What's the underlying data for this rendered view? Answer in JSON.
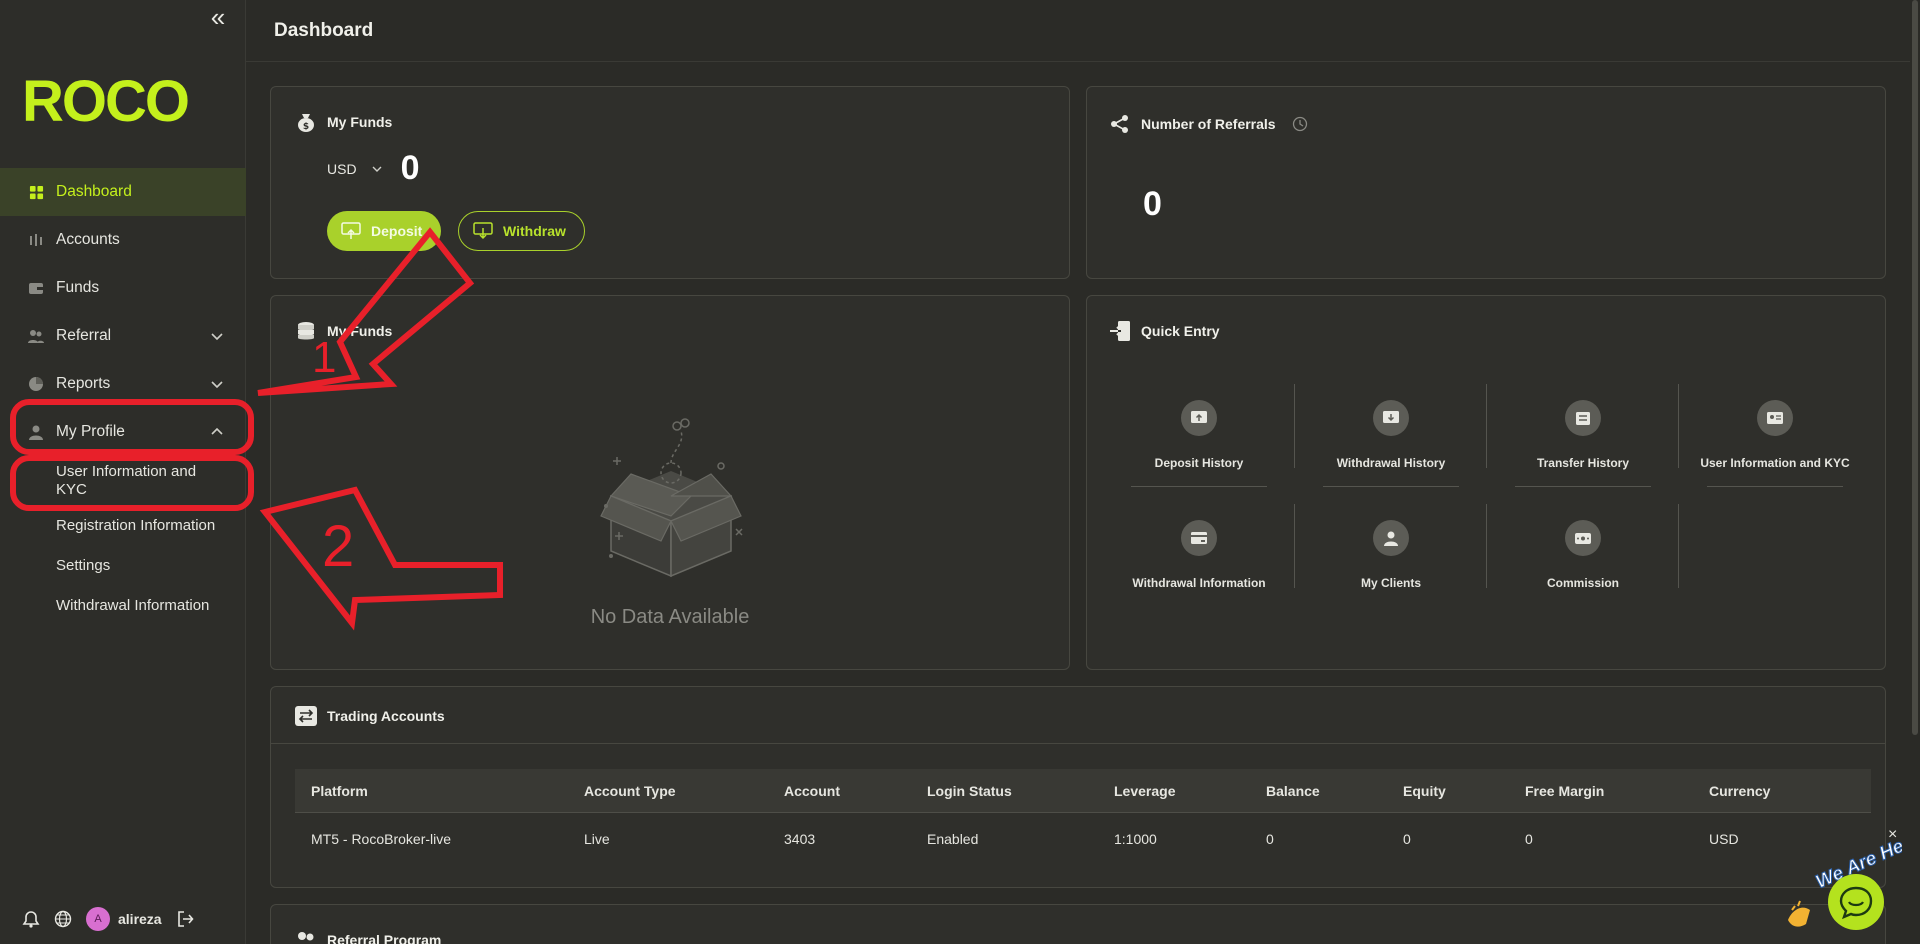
{
  "sidebar": {
    "logo": "ROCO",
    "items": [
      {
        "label": "Dashboard"
      },
      {
        "label": "Accounts"
      },
      {
        "label": "Funds"
      },
      {
        "label": "Referral"
      },
      {
        "label": "Reports"
      },
      {
        "label": "My Profile"
      }
    ],
    "sub_items": [
      {
        "label": "User Information and KYC"
      },
      {
        "label": "Registration Information"
      },
      {
        "label": "Settings"
      },
      {
        "label": "Withdrawal Information"
      }
    ],
    "user": {
      "initial": "A",
      "name": "alireza"
    }
  },
  "header": {
    "title": "Dashboard"
  },
  "funds_card": {
    "title": "My Funds",
    "currency": "USD",
    "amount": "0",
    "deposit_label": "Deposit",
    "withdraw_label": "Withdraw"
  },
  "referrals_card": {
    "title": "Number of Referrals",
    "value": "0"
  },
  "funds_chart_card": {
    "title": "My Funds",
    "empty_text": "No Data Available"
  },
  "quick_entry": {
    "title": "Quick Entry",
    "items": [
      {
        "label": "Deposit History"
      },
      {
        "label": "Withdrawal History"
      },
      {
        "label": "Transfer History"
      },
      {
        "label": "User Information and KYC"
      },
      {
        "label": "Withdrawal Information"
      },
      {
        "label": "My Clients"
      },
      {
        "label": "Commission"
      }
    ]
  },
  "trading_accounts": {
    "title": "Trading Accounts",
    "columns": [
      "Platform",
      "Account Type",
      "Account",
      "Login Status",
      "Leverage",
      "Balance",
      "Equity",
      "Free Margin",
      "Currency"
    ],
    "rows": [
      [
        "MT5 - RocoBroker-live",
        "Live",
        "3403",
        "Enabled",
        "1:1000",
        "0",
        "0",
        "0",
        "USD"
      ]
    ]
  },
  "referral_program": {
    "title": "Referral Program"
  },
  "chat": {
    "badge_text": "We Are Here!",
    "close": "×"
  },
  "annotations": {
    "label_1": "1",
    "label_2": "2"
  },
  "colors": {
    "accent": "#c4f01c",
    "button": "#a9d12b",
    "annotation": "#e8202a",
    "background": "#2b2b27"
  }
}
